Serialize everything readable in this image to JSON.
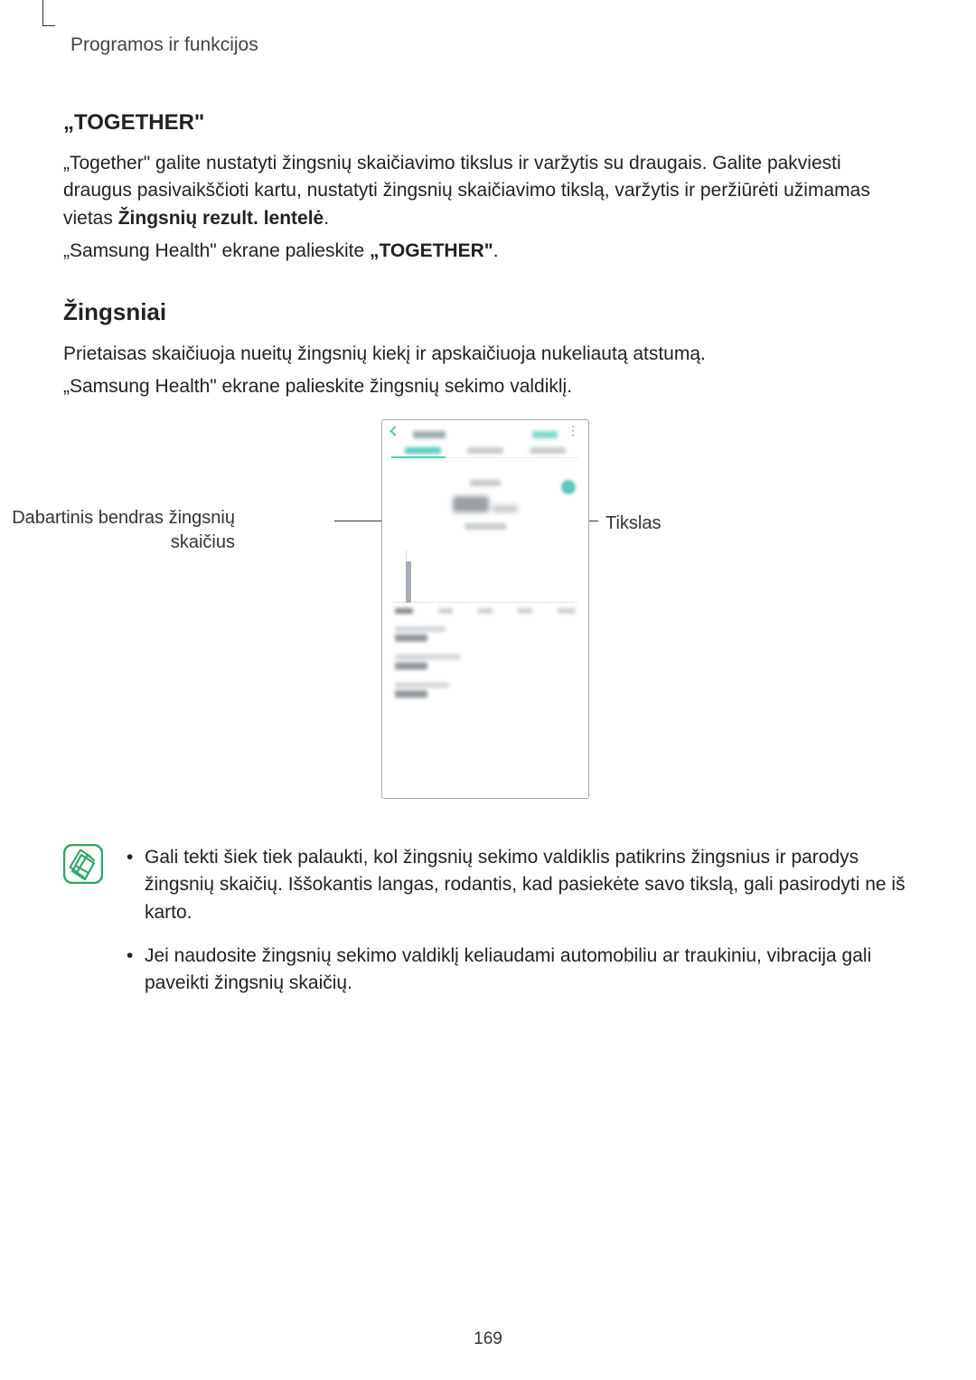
{
  "header": "Programos ir funkcijos",
  "section1": {
    "title": "„TOGETHER\"",
    "p1_a": "„Together\" galite nustatyti žingsnių skaičiavimo tikslus ir varžytis su draugais. Galite pakviesti draugus pasivaikščioti kartu, nustatyti žingsnių skaičiavimo tikslą, varžytis ir peržiūrėti užimamas vietas ",
    "p1_bold": "Žingsnių rezult. lentelė",
    "p1_b": ".",
    "p2_a": "„Samsung Health\" ekrane palieskite ",
    "p2_bold": "„TOGETHER\"",
    "p2_b": "."
  },
  "section2": {
    "title": "Žingsniai",
    "p1": "Prietaisas skaičiuoja nueitų žingsnių kiekį ir apskaičiuoja nukeliautą atstumą.",
    "p2": "„Samsung Health\" ekrane palieskite žingsnių sekimo valdiklį."
  },
  "callouts": {
    "left": "Dabartinis bendras žingsnių skaičius",
    "right": "Tikslas"
  },
  "notes": {
    "item1": "Gali tekti šiek tiek palaukti, kol žingsnių sekimo valdiklis patikrins žingsnius ir parodys žingsnių skaičių. Iššokantis langas, rodantis, kad pasiekėte savo tikslą, gali pasirodyti ne iš karto.",
    "item2": "Jei naudosite žingsnių sekimo valdiklį keliaudami automobiliu ar traukiniu, vibracija gali paveikti žingsnių skaičių."
  },
  "page_number": "169"
}
